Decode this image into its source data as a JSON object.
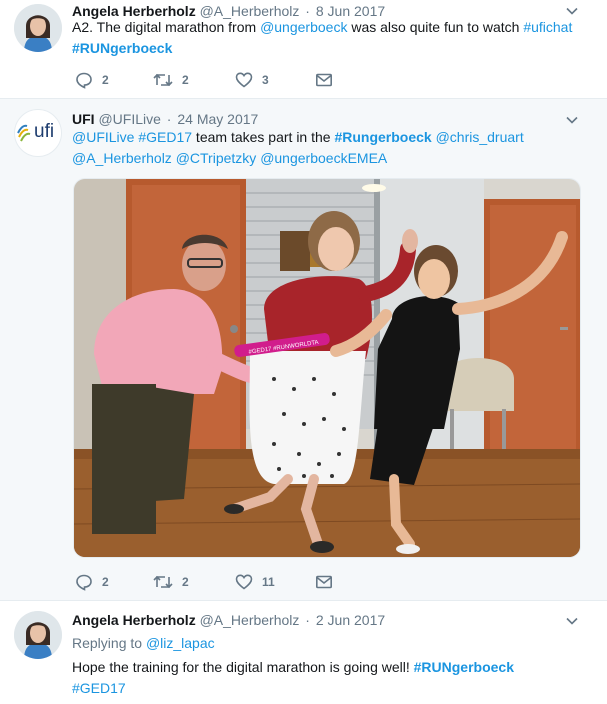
{
  "tweets": [
    {
      "name": "Angela Herberholz",
      "handle": "@A_Herberholz",
      "date": "8 Jun 2017",
      "text_segments": [
        {
          "t": "A2. The digital marathon from "
        },
        {
          "t": "@ungerboeck"
        },
        {
          "t": " was also quite fun to watch "
        },
        {
          "t": "#ufichat"
        },
        {
          "t": "#RUNgerboeck"
        }
      ],
      "stats": {
        "replies": "2",
        "retweets": "2",
        "likes": "3"
      }
    },
    {
      "name": "UFI",
      "handle": "@UFILive",
      "date": "24 May 2017",
      "avatar_logo_text": "ufi",
      "text_segments": [
        {
          "t": "@UFILive"
        },
        {
          "t": "#GED17"
        },
        {
          "t": " team takes part in the "
        },
        {
          "t": "#Rungerboeck"
        },
        {
          "t": "@chris_druart"
        },
        {
          "t": "@A_Herberholz"
        },
        {
          "t": "@CTripetzky"
        },
        {
          "t": "@ungerboeckEMEA"
        }
      ],
      "media": {
        "baton_text": "#GED17 #RUNWORLDTA"
      },
      "stats": {
        "replies": "2",
        "retweets": "2",
        "likes": "11"
      }
    },
    {
      "name": "Angela Herberholz",
      "handle": "@A_Herberholz",
      "date": "2 Jun 2017",
      "replying_label": "Replying to",
      "replying_to": "@liz_lapac",
      "text_segments": [
        {
          "t": "Hope the training for the digital marathon is going well! "
        },
        {
          "t": "#RUNgerboeck"
        },
        {
          "t": "#GED17"
        }
      ]
    }
  ],
  "colors": {
    "link": "#1b95e0",
    "muted": "#657786",
    "text": "#14171a",
    "border": "#e6ecf0"
  },
  "icons": {
    "reply": "reply-icon",
    "retweet": "retweet-icon",
    "like": "heart-icon",
    "dm": "envelope-icon",
    "more": "chevron-down-icon"
  }
}
